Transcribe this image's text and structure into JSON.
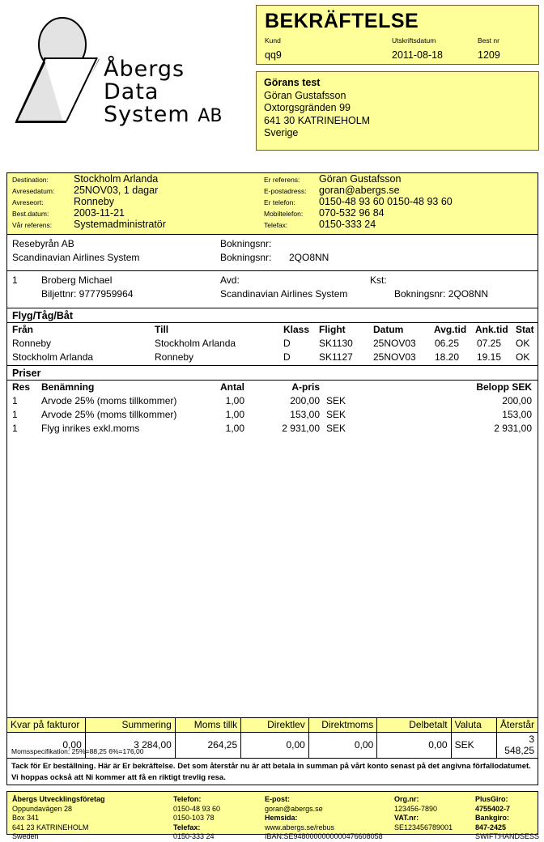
{
  "logo": {
    "lines": [
      "Åbergs",
      "Data",
      "System"
    ],
    "suffix": "AB",
    "alt": "abergs-data-system-ab-logo"
  },
  "header": {
    "title": "BEKRÄFTELSE",
    "labels": {
      "kund": "Kund",
      "utskriftsdatum": "Utskriftsdatum",
      "bestnr": "Best nr"
    },
    "values": {
      "kund": "qq9",
      "utskriftsdatum": "2011-08-18",
      "bestnr": "1209"
    }
  },
  "customer": {
    "name": "Görans test",
    "contact": "Göran Gustafsson",
    "street": "Oxtorgsgränden 99",
    "city": "641 30 KATRINEHOLM",
    "country": "Sverige"
  },
  "trip": {
    "left": [
      {
        "label": "Destination:",
        "value": "Stockholm Arlanda"
      },
      {
        "label": "Avresedatum:",
        "value": "25NOV03, 1 dagar"
      },
      {
        "label": "Avreseort:",
        "value": "Ronneby"
      },
      {
        "label": "Best.datum:",
        "value": "2003-11-21"
      },
      {
        "label": "Vår referens:",
        "value": "Systemadministratör"
      }
    ],
    "right": [
      {
        "label": "Er referens:",
        "value": "Göran Gustafsson"
      },
      {
        "label": "E-postadress:",
        "value": "goran@abergs.se"
      },
      {
        "label": "Er telefon:",
        "value": "0150-48 93 60 0150-48 93 60"
      },
      {
        "label": "Mobiltelefon:",
        "value": "070-532 96 84"
      },
      {
        "label": "Telefax:",
        "value": "0150-333 24"
      }
    ]
  },
  "agency": {
    "row1_name": "Resebyrån AB",
    "row1_booking_label": "Bokningsnr:",
    "row1_booking_value": "",
    "row2_name": "Scandinavian Airlines System",
    "row2_booking_label": "Bokningsnr:",
    "row2_booking_value": "2QO8NN"
  },
  "passenger": {
    "num": "1",
    "name": "Broberg Michael",
    "ticket": "Biljettnr: 9777959964",
    "avd_label": "Avd:",
    "kst_label": "Kst:",
    "supplier": "Scandinavian Airlines System",
    "booking": "Bokningsnr: 2QO8NN"
  },
  "sections": {
    "travel": "Flyg/Tåg/Båt",
    "prices": "Priser"
  },
  "flight_table": {
    "headers": [
      "Från",
      "Till",
      "Klass",
      "Flight",
      "Datum",
      "Avg.tid",
      "Ank.tid",
      "Stat"
    ],
    "rows": [
      [
        "Ronneby",
        "Stockholm Arlanda",
        "D",
        "SK1130",
        "25NOV03",
        "06.25",
        "07.25",
        "OK"
      ],
      [
        "Stockholm Arlanda",
        "Ronneby",
        "D",
        "SK1127",
        "25NOV03",
        "18.20",
        "19.15",
        "OK"
      ]
    ]
  },
  "price_table": {
    "headers": [
      "Res",
      "Benämning",
      "Antal",
      "A-pris",
      "Belopp SEK"
    ],
    "rows": [
      [
        "1",
        "Arvode 25% (moms tillkommer)",
        "1,00",
        "200,00",
        "SEK",
        "200,00"
      ],
      [
        "1",
        "Arvode 25% (moms tillkommer)",
        "1,00",
        "153,00",
        "SEK",
        "153,00"
      ],
      [
        "1",
        "Flyg inrikes exkl.moms",
        "1,00",
        "2 931,00",
        "SEK",
        "2 931,00"
      ]
    ]
  },
  "summary": {
    "headers": [
      "Kvar på fakturor",
      "Summering",
      "Moms tillk",
      "Direktlev",
      "Direktmoms",
      "Delbetalt",
      "Valuta",
      "Återstår"
    ],
    "values": [
      "0,00",
      "3 284,00",
      "264,25",
      "0,00",
      "0,00",
      "0,00",
      "SEK",
      "3 548,25"
    ]
  },
  "moms_spec": "Momsspecifikation: 25%=88,25  6%=176,00",
  "thanks": "Tack för Er beställning. Här är Er bekräftelse. Det som återstår nu är att betala in summan på vårt konto senast på det angivna förfallodatumet. Vi hoppas också att Ni kommer att få en riktigt trevlig resa.",
  "footer": {
    "col1": [
      "Åbergs Utvecklingsföretag",
      "Oppundavägen 28",
      "Box 341",
      "641 23 KATRINEHOLM",
      "Sweden"
    ],
    "col2": [
      "Telefon:",
      "0150-48 93 60",
      "0150-103 78",
      "Telefax:",
      "0150-333 24"
    ],
    "col3": [
      "E-post:",
      "goran@abergs.se",
      "Hemsida:",
      "www.abergs.se/rebus",
      "IBAN:SE9480000000000476608058"
    ],
    "col4": [
      "Org.nr:",
      "123456-7890",
      "VAT.nr:",
      "SE123456789001"
    ],
    "col5": [
      "PlusGiro:",
      "4755402-7",
      "Bankgiro:",
      "847-2425",
      "SWIFT:HANDSESS"
    ]
  },
  "colors": {
    "yellow": "#ffff99",
    "border": "#000000",
    "title_box_border": "#7a5a2a"
  }
}
